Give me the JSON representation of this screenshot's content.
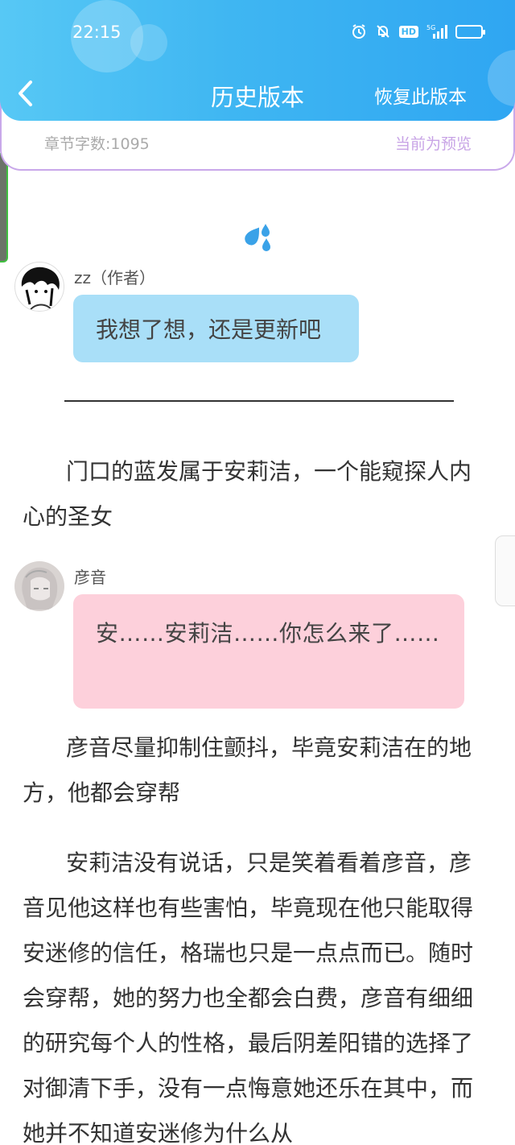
{
  "status_bar": {
    "time": "22:15",
    "icons": [
      "alarm-icon",
      "mute-icon",
      "hd-icon",
      "signal-5g-icon",
      "battery-icon"
    ],
    "hd_label": "HD",
    "network_label": "5G"
  },
  "header": {
    "title": "历史版本",
    "restore_label": "恢复此版本",
    "back_icon": "chevron-left-icon"
  },
  "info": {
    "word_count": "章节字数:1095",
    "preview_label": "当前为预览"
  },
  "chat": [
    {
      "speaker": "zz（作者）",
      "text": "我想了想，还是更新吧"
    },
    {
      "speaker": "彦音",
      "text": "安……安莉洁……你怎么来了……"
    }
  ],
  "paragraphs": [
    "门口的蓝发属于安莉洁，一个能窥探人内心的圣女",
    "彦音尽量抑制住颤抖，毕竟安莉洁在的地方，他都会穿帮",
    "安莉洁没有说话，只是笑着看着彦音，彦音见他这样也有些害怕，毕竟现在他只能取得安迷修的信任，格瑞也只是一点点而已。随时会穿帮，她的努力也全都会白费，彦音有细细的研究每个人的性格，最后阴差阳错的选择了对御清下手，没有一点悔意她还乐在其中，而她并不知道安迷修为什么从"
  ],
  "colors": {
    "header_gradient_start": "#57c8f5",
    "header_gradient_end": "#2fa6f2",
    "author_bubble": "#a9dff8",
    "character_bubble": "#fdd0db",
    "preview_accent": "#c8a4e6"
  }
}
